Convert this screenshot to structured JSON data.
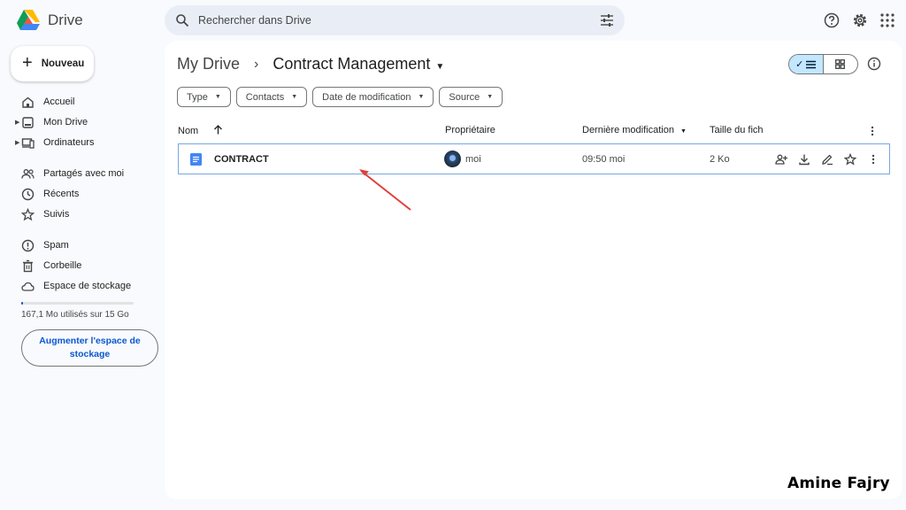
{
  "app": {
    "name": "Drive"
  },
  "search": {
    "placeholder": "Rechercher dans Drive"
  },
  "sidebar": {
    "new_label": "Nouveau",
    "items": [
      {
        "label": "Accueil",
        "icon": "home-icon"
      },
      {
        "label": "Mon Drive",
        "icon": "my-drive-icon"
      },
      {
        "label": "Ordinateurs",
        "icon": "computers-icon"
      },
      {
        "label": "Partagés avec moi",
        "icon": "shared-icon"
      },
      {
        "label": "Récents",
        "icon": "clock-icon"
      },
      {
        "label": "Suivis",
        "icon": "star-icon"
      },
      {
        "label": "Spam",
        "icon": "spam-icon"
      },
      {
        "label": "Corbeille",
        "icon": "trash-icon"
      },
      {
        "label": "Espace de stockage",
        "icon": "cloud-icon"
      }
    ],
    "storage_text": "167,1 Mo utilisés sur 15 Go",
    "storage_used_fraction": 0.011,
    "storage_button": "Augmenter l'espace de stockage"
  },
  "breadcrumb": {
    "root": "My Drive",
    "current": "Contract Management"
  },
  "filters": [
    "Type",
    "Contacts",
    "Date de modification",
    "Source"
  ],
  "table": {
    "columns": {
      "name": "Nom",
      "owner": "Propriétaire",
      "modified": "Dernière modification",
      "size": "Taille du fich"
    },
    "rows": [
      {
        "name": "CONTRACT",
        "owner": "moi",
        "modified": "09:50 moi",
        "size": "2 Ko"
      }
    ]
  },
  "watermark": "Amine Fajry",
  "colors": {
    "accent": "#0b57d0",
    "toggle_active": "#c2e7ff",
    "doc_icon": "#4285f4",
    "arrow": "#e0403a"
  }
}
